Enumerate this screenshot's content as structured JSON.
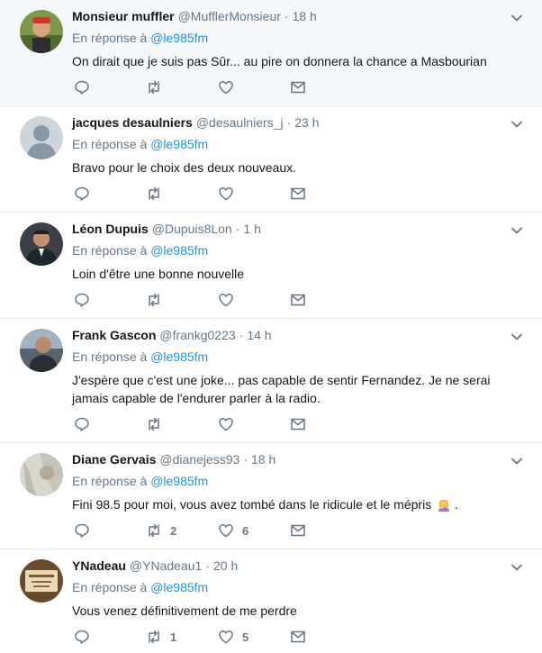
{
  "tweets": [
    {
      "name": "Monsieur muffler",
      "handle": "@MufflerMonsieur",
      "separator": "·",
      "time": "18 h",
      "reply_prefix": "En réponse à",
      "reply_mention": "@le985fm",
      "text": "On dirait que je suis pas Sûr... au pire on donnera la chance a Masbourian",
      "retweets": "",
      "likes": ""
    },
    {
      "name": "jacques desaulniers",
      "handle": "@desaulniers_j",
      "separator": "·",
      "time": "23 h",
      "reply_prefix": "En réponse à",
      "reply_mention": "@le985fm",
      "text": "Bravo pour le choix des deux nouveaux.",
      "retweets": "",
      "likes": ""
    },
    {
      "name": "Léon Dupuis",
      "handle": "@Dupuis8Lon",
      "separator": "·",
      "time": "1 h",
      "reply_prefix": "En réponse à",
      "reply_mention": "@le985fm",
      "text": "Loin d'être une bonne nouvelle",
      "retweets": "",
      "likes": ""
    },
    {
      "name": "Frank Gascon",
      "handle": "@frankg0223",
      "separator": "·",
      "time": "14 h",
      "reply_prefix": "En réponse à",
      "reply_mention": "@le985fm",
      "text": "J'espère que c'est une joke... pas capable de sentir Fernandez. Je ne serai jamais capable de l'endurer parler à la radio.",
      "retweets": "",
      "likes": ""
    },
    {
      "name": "Diane Gervais",
      "handle": "@dianejess93",
      "separator": "·",
      "time": "18 h",
      "reply_prefix": "En réponse à",
      "reply_mention": "@le985fm",
      "text": "Fini 98.5 pour moi, vous avez tombé dans le ridicule et le mépris",
      "text_suffix": ".",
      "retweets": "2",
      "likes": "6"
    },
    {
      "name": "YNadeau",
      "handle": "@YNadeau1",
      "separator": "·",
      "time": "20 h",
      "reply_prefix": "En réponse à",
      "reply_mention": "@le985fm",
      "text": "Vous venez définitivement de me perdre",
      "retweets": "1",
      "likes": "5"
    }
  ],
  "colors": {
    "link": "#1b95e0",
    "muted": "#657786",
    "text": "#14171a",
    "highlight_bg": "#f5f8fa",
    "divider": "#e6ecf0"
  },
  "icons": {
    "reply": "reply-icon",
    "retweet": "retweet-icon",
    "like": "heart-icon",
    "dm": "envelope-icon",
    "more": "chevron-down-icon",
    "emoji": "woman-facepalming-emoji"
  }
}
